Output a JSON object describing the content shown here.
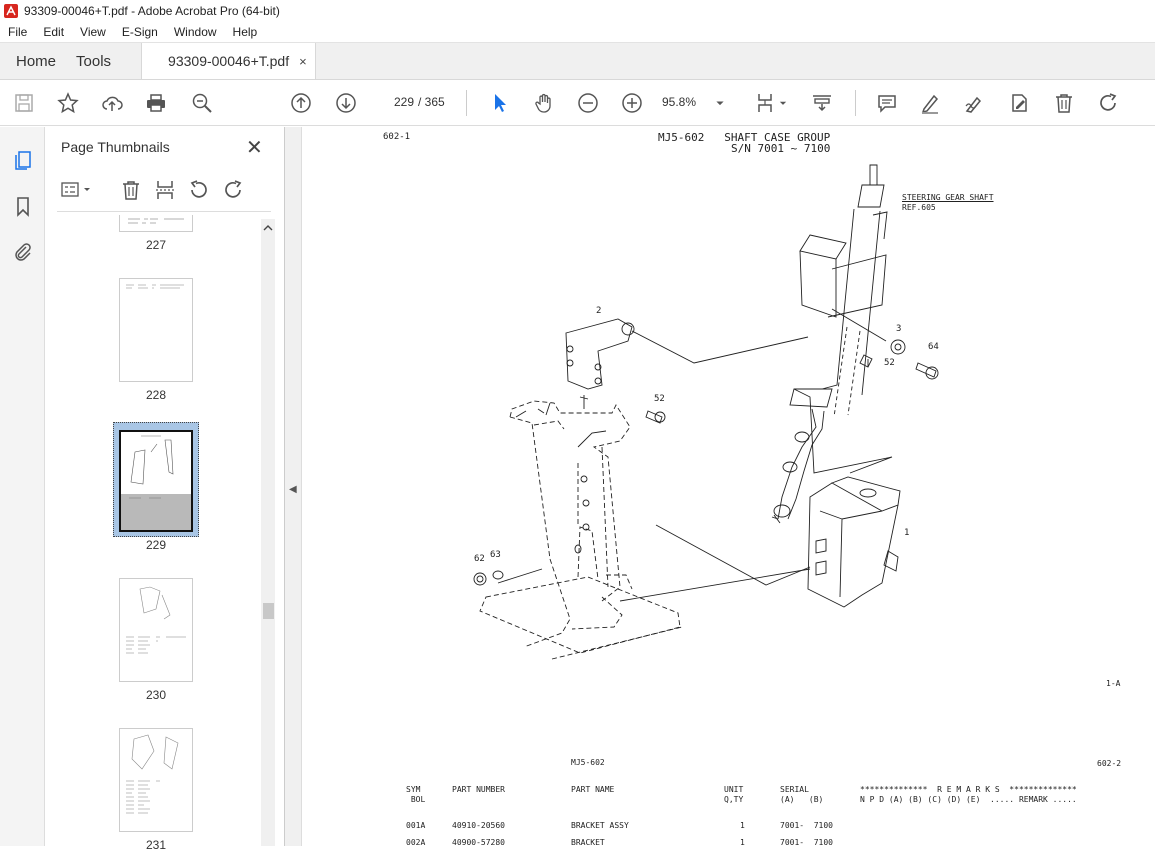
{
  "window": {
    "title": "93309-00046+T.pdf - Adobe Acrobat Pro (64-bit)"
  },
  "menu": [
    "File",
    "Edit",
    "View",
    "E-Sign",
    "Window",
    "Help"
  ],
  "tabs": {
    "home": "Home",
    "tools": "Tools",
    "document": "93309-00046+T.pdf",
    "close": "×"
  },
  "toolbar": {
    "current_page": "229",
    "total_pages": "/ 365",
    "zoom": "95.8%"
  },
  "panel": {
    "title": "Page Thumbnails",
    "close": "✕"
  },
  "thumbnails": [
    {
      "label": "227"
    },
    {
      "label": "228"
    },
    {
      "label": "229",
      "selected": true
    },
    {
      "label": "230"
    },
    {
      "label": "231"
    }
  ],
  "document": {
    "page_id_left": "602-1",
    "title_line1": "MJ5-602   SHAFT CASE GROUP",
    "title_line2": "S/N 7001 ~ 7100",
    "callout_steering": "STEERING GEAR SHAFT",
    "callout_ref": "REF.605",
    "labels": [
      "2",
      "3",
      "64",
      "52",
      "52",
      "1",
      "62",
      "63"
    ],
    "corner_mark": "1-A",
    "table_group": "MJ5-602",
    "table_page": "602-2",
    "table_headers": {
      "sym": "SYM\n BOL",
      "part_number": "PART NUMBER",
      "part_name": "PART NAME",
      "unit": "UNIT\nQ,TY",
      "serial": "SERIAL\n(A)   (B)",
      "remarks_line1": "**************  R E M A R K S  **************",
      "remarks_line2": "N P D (A) (B) (C) (D) (E)  ..... REMARK ....."
    },
    "rows": [
      {
        "sym": "001A",
        "part_number": "40910-20560",
        "part_name": "BRACKET ASSY",
        "qty": "1",
        "serial": "7001-  7100"
      },
      {
        "sym": "002A",
        "part_number": "40900-57280",
        "part_name": "BRACKET",
        "qty": "1",
        "serial": "7001-  7100"
      }
    ]
  }
}
